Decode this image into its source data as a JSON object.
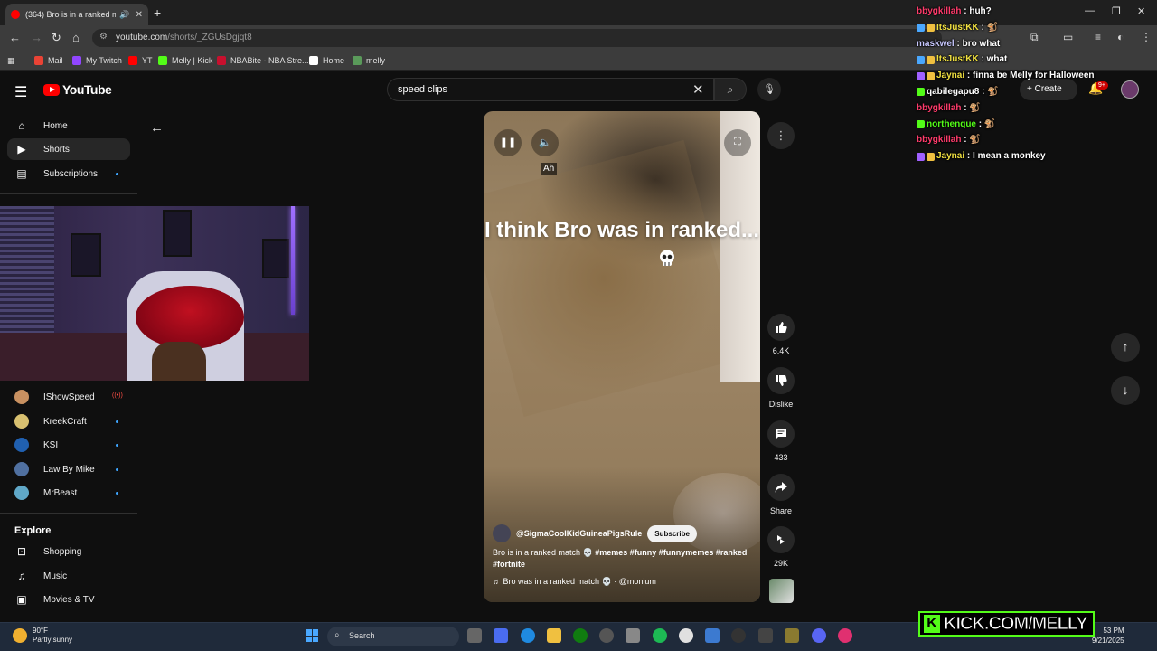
{
  "browser": {
    "tab_title": "(364) Bro is in a ranked match",
    "url_host": "youtube.com",
    "url_path": "/shorts/_ZGUsDgjqt8",
    "bookmarks": [
      {
        "label": "Mail",
        "color": "#ea4335"
      },
      {
        "label": "My Twitch",
        "color": "#9146ff"
      },
      {
        "label": "YT",
        "color": "#ff0000"
      },
      {
        "label": "Melly | Kick",
        "color": "#53fc18"
      },
      {
        "label": "NBABite - NBA Stre...",
        "color": "#c8102e"
      },
      {
        "label": "Home",
        "color": "#ffffff"
      },
      {
        "label": "melly",
        "color": "#5a9a5a"
      }
    ]
  },
  "youtube": {
    "logo_text": "YouTube",
    "search_value": "speed clips",
    "create_label": "Create",
    "notif_count": "9+",
    "sidebar": {
      "main": [
        {
          "label": "Home",
          "icon": "home-icon"
        },
        {
          "label": "Shorts",
          "icon": "shorts-icon"
        },
        {
          "label": "Subscriptions",
          "icon": "subscriptions-icon"
        }
      ],
      "channels": [
        {
          "label": "IShowSpeed",
          "color": "#c89060"
        },
        {
          "label": "KreekCraft",
          "color": "#d8c070"
        },
        {
          "label": "KSI",
          "color": "#2060b0"
        },
        {
          "label": "Law By Mike",
          "color": "#5070a0"
        },
        {
          "label": "MrBeast",
          "color": "#60a8c8"
        }
      ],
      "explore_heading": "Explore",
      "explore": [
        {
          "label": "Shopping",
          "icon": "shopping-bag-icon"
        },
        {
          "label": "Music",
          "icon": "music-note-icon"
        },
        {
          "label": "Movies & TV",
          "icon": "film-icon"
        }
      ]
    },
    "short": {
      "sfx_caption": "Ah",
      "caption": "I think Bro was in ranked...",
      "channel": "@SigmaCoolKidGuineaPigsRule",
      "subscribe_label": "Subscribe",
      "description": "Bro is in a ranked match 💀",
      "hashtags": "#memes #funny #funnymemes #ranked #fortnite",
      "sound": "Bro was in a ranked match 💀 · @monium",
      "likes": "6.4K",
      "dislike_label": "Dislike",
      "comments": "433",
      "share_label": "Share",
      "remixes": "29K"
    }
  },
  "chat": [
    {
      "user": "bbygkillah",
      "color": "#ff3b6b",
      "msg": "huh?",
      "badges": []
    },
    {
      "user": "ItsJustKK",
      "color": "#f0e040",
      "msg": "🐒",
      "badges": [
        "#4aa8ff",
        "#f0c040"
      ]
    },
    {
      "user": "maskwel",
      "color": "#c8c8ff",
      "msg": "bro what",
      "badges": []
    },
    {
      "user": "ItsJustKK",
      "color": "#f0e040",
      "msg": "what",
      "badges": [
        "#4aa8ff",
        "#f0c040"
      ]
    },
    {
      "user": "Jaynai",
      "color": "#f0e040",
      "msg": "finna be Melly for Halloween",
      "badges": [
        "#a060ff",
        "#f0c040"
      ]
    },
    {
      "user": "qabilegapu8",
      "color": "#ffffff",
      "msg": "🐒",
      "badges": [
        "#53fc18"
      ]
    },
    {
      "user": "bbygkillah",
      "color": "#ff3b6b",
      "msg": "🐒",
      "badges": []
    },
    {
      "user": "northenque",
      "color": "#53fc18",
      "msg": "🐒",
      "badges": [
        "#53fc18"
      ]
    },
    {
      "user": "bbygkillah",
      "color": "#ff3b6b",
      "msg": "🐒",
      "badges": []
    },
    {
      "user": "Jaynai",
      "color": "#f0e040",
      "msg": "I mean a monkey",
      "badges": [
        "#a060ff",
        "#f0c040"
      ]
    }
  ],
  "taskbar": {
    "temp": "90°F",
    "condition": "Partly sunny",
    "search_label": "Search",
    "time": "53 PM",
    "date": "9/21/2025"
  },
  "overlay": {
    "kick_text": "KICK.COM/MELLY",
    "kick_k": "K"
  }
}
